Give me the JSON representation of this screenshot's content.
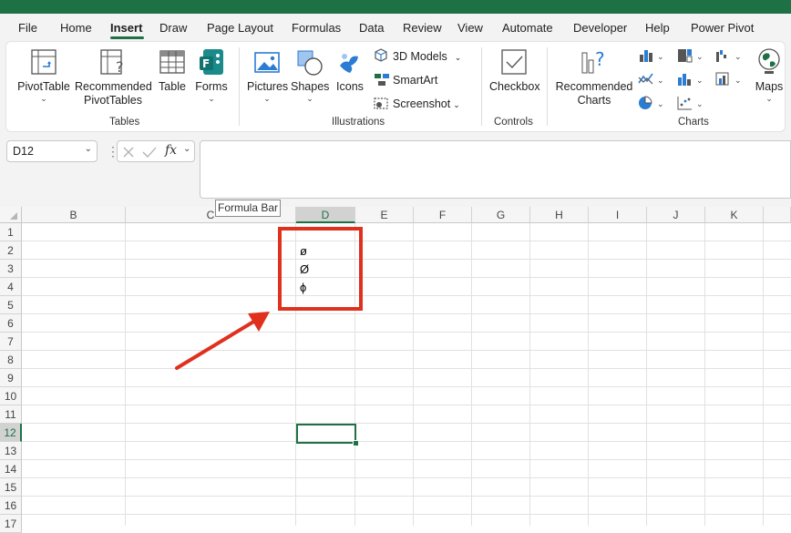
{
  "tabs": [
    "File",
    "Home",
    "Insert",
    "Draw",
    "Page Layout",
    "Formulas",
    "Data",
    "Review",
    "View",
    "Automate",
    "Developer",
    "Help",
    "Power Pivot"
  ],
  "active_tab": "Insert",
  "ribbon": {
    "tables": {
      "pivottable": "PivotTable",
      "recommended_pivot_line1": "Recommended",
      "recommended_pivot_line2": "PivotTables",
      "table": "Table",
      "forms": "Forms",
      "group": "Tables"
    },
    "illustrations": {
      "pictures": "Pictures",
      "shapes": "Shapes",
      "icons": "Icons",
      "models": "3D Models",
      "smartart": "SmartArt",
      "screenshot": "Screenshot",
      "group": "Illustrations"
    },
    "controls": {
      "checkbox": "Checkbox",
      "group": "Controls"
    },
    "charts": {
      "recommended_line1": "Recommended",
      "recommended_line2": "Charts",
      "maps": "Maps",
      "group": "Charts"
    }
  },
  "formula_bar": {
    "name_box": "D12",
    "fx": "fx",
    "tooltip": "Formula Bar"
  },
  "columns": [
    "B",
    "C",
    "D",
    "E",
    "F",
    "G",
    "H",
    "I",
    "J",
    "K"
  ],
  "rows": [
    "1",
    "2",
    "3",
    "4",
    "5",
    "6",
    "7",
    "8",
    "9",
    "10",
    "11",
    "12",
    "13",
    "14",
    "15",
    "16",
    "17"
  ],
  "selected_column": "D",
  "selected_row": "12",
  "cells": {
    "D2": "ø",
    "D3": "Ø",
    "D4": "ϕ"
  },
  "colors": {
    "accent": "#1e7145",
    "highlight": "#e0301e"
  }
}
